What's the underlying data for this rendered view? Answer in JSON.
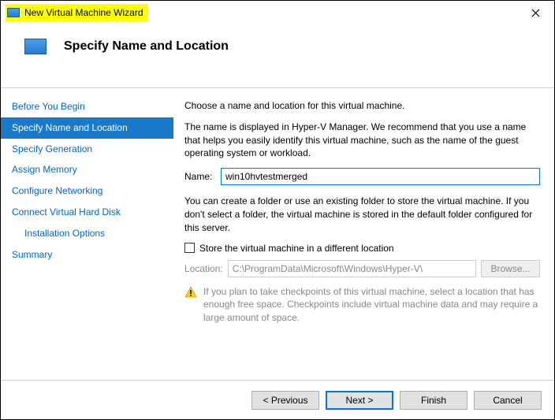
{
  "window": {
    "title": "New Virtual Machine Wizard"
  },
  "header": {
    "title": "Specify Name and Location"
  },
  "sidebar": {
    "items": [
      {
        "label": "Before You Begin",
        "selected": false
      },
      {
        "label": "Specify Name and Location",
        "selected": true
      },
      {
        "label": "Specify Generation",
        "selected": false
      },
      {
        "label": "Assign Memory",
        "selected": false
      },
      {
        "label": "Configure Networking",
        "selected": false
      },
      {
        "label": "Connect Virtual Hard Disk",
        "selected": false
      },
      {
        "label": "Installation Options",
        "selected": false,
        "sub": true
      },
      {
        "label": "Summary",
        "selected": false
      }
    ]
  },
  "content": {
    "intro": "Choose a name and location for this virtual machine.",
    "name_help": "The name is displayed in Hyper-V Manager. We recommend that you use a name that helps you easily identify this virtual machine, such as the name of the guest operating system or workload.",
    "name_label": "Name:",
    "name_value": "win10hvtestmerged",
    "folder_help": "You can create a folder or use an existing folder to store the virtual machine. If you don't select a folder, the virtual machine is stored in the default folder configured for this server.",
    "store_checkbox_label": "Store the virtual machine in a different location",
    "store_checked": false,
    "location_label": "Location:",
    "location_value": "C:\\ProgramData\\Microsoft\\Windows\\Hyper-V\\",
    "browse_label": "Browse...",
    "warning_text": "If you plan to take checkpoints of this virtual machine, select a location that has enough free space. Checkpoints include virtual machine data and may require a large amount of space."
  },
  "footer": {
    "previous": "< Previous",
    "next": "Next >",
    "finish": "Finish",
    "cancel": "Cancel"
  }
}
